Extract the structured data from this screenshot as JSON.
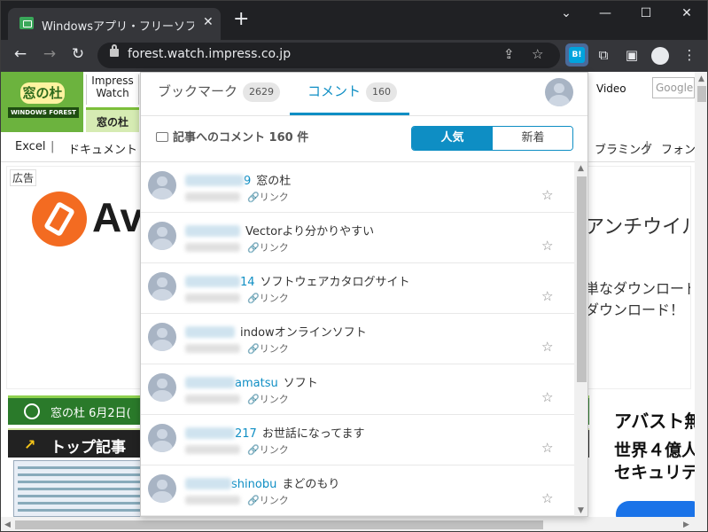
{
  "browser": {
    "tab_title": "Windowsアプリ・フリーソフトのおすすめ",
    "tab_close": "✕",
    "new_tab": "+",
    "minimize": "⌄",
    "min2": "—",
    "maximize": "☐",
    "close": "✕",
    "url": "forest.watch.impress.co.jp",
    "back": "←",
    "forward": "→",
    "reload": "↻",
    "share": "⇪",
    "bookmark_star": "☆",
    "hatena_badge": "B!",
    "extensions": "⧉",
    "sidebar": "▣",
    "menu": "⋮"
  },
  "page": {
    "logo_main": "窓の杜",
    "logo_sub": "WINDOWS FOREST",
    "impress_watch": "Impress Watch",
    "mado_tab": "窓の杜",
    "video": "Video",
    "google": "Google",
    "categories": [
      {
        "label": "Excel"
      },
      {
        "label": "|"
      },
      {
        "label": "ドキュメント"
      },
      {
        "label": "ブラミング"
      },
      {
        "label": "|"
      },
      {
        "label": "フォン"
      }
    ],
    "ad_label": "広告",
    "ad_brand_partial": "Av",
    "ad_right_1": "アンチウイル",
    "ad_right_2": "単なダウンロード",
    "ad_right_3": "ダウンロード！",
    "date_text": "窓の杜 6月2日(",
    "top_articles": "トップ記事",
    "right_ad_1": "アバスト無",
    "right_ad_2": "世界４億人",
    "right_ad_3": "セキュリテ"
  },
  "popup": {
    "tab_bookmark": "ブックマーク",
    "tab_bookmark_count": "2629",
    "tab_comment": "コメント",
    "tab_comment_count": "160",
    "heading": "記事へのコメント 160 件",
    "seg_popular": "人気",
    "seg_new": "新着",
    "link_label": "リンク",
    "link_icon": "🔗",
    "star_icon": "☆",
    "comments": [
      {
        "user_tail": "9",
        "text": "窓の杜"
      },
      {
        "user_tail": "",
        "text": "Vectorより分かりやすい"
      },
      {
        "user_tail": "14",
        "text": "ソフトウェアカタログサイト"
      },
      {
        "user_tail": "",
        "text": "indowオンラインソフト"
      },
      {
        "user_tail": "amatsu",
        "text": "ソフト"
      },
      {
        "user_tail": "217",
        "text": "お世話になってます"
      },
      {
        "user_tail": "shinobu",
        "text": "まどのもり"
      }
    ]
  },
  "colors": {
    "accent": "#0e8ec4",
    "forest_green": "#6cb33e",
    "avast_orange": "#f36b21"
  }
}
